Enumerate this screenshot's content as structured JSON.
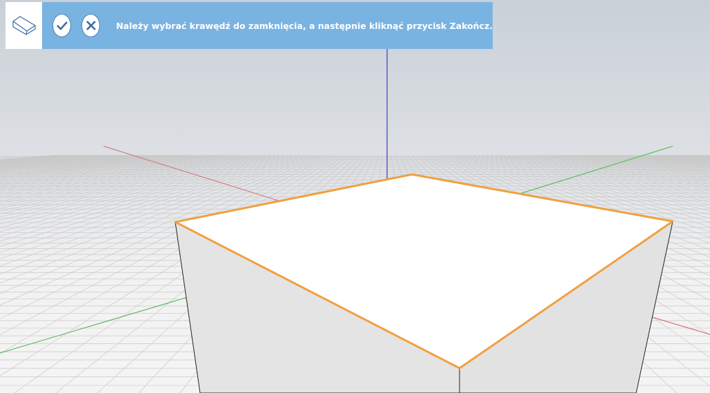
{
  "toolbar": {
    "tool_icon": "chamfer-edge-icon",
    "confirm_icon": "checkmark-icon",
    "cancel_icon": "close-icon",
    "message": "Należy wybrać krawędź do zamknięcia, a następnie kliknąć przycisk Zakończ."
  },
  "colors": {
    "toolbar_bg": "#79b3e2",
    "selection_edge": "#f0a040",
    "axis_x": "#c84040",
    "axis_y": "#40b040",
    "axis_z": "#4040c0"
  }
}
